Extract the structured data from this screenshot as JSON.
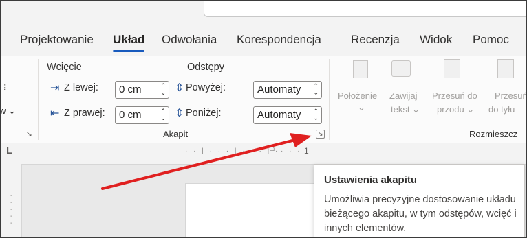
{
  "tabs": [
    "Projektowanie",
    "Układ",
    "Odwołania",
    "Korespondencja",
    "Recenzja",
    "Widok",
    "Pomoc"
  ],
  "active_tab": "Układ",
  "left_partial": {
    "dropdown_label": "w"
  },
  "indent": {
    "title": "Wcięcie",
    "left_label": "Z lewej:",
    "left_value": "0 cm",
    "right_label": "Z prawej:",
    "right_value": "0 cm"
  },
  "spacing": {
    "title": "Odstępy",
    "before_label": "Powyżej:",
    "before_value": "Automaty",
    "after_label": "Poniżej:",
    "after_value": "Automaty"
  },
  "group_label_paragraph": "Akapit",
  "arrange": {
    "position_l1": "Położenie",
    "wrap_l1": "Zawijaj",
    "wrap_l2": "tekst",
    "forward_l1": "Przesuń do",
    "forward_l2": "przodu",
    "backward_l1": "Przesuń",
    "backward_l2": "do tyłu",
    "group_label": "Rozmieszcz"
  },
  "ruler_number": "1",
  "tooltip": {
    "title": "Ustawienia akapitu",
    "description": "Umożliwia precyzyjne dostosowanie układu bieżącego akapitu, w tym odstępów, wcięć i innych elementów."
  },
  "colors": {
    "accent": "#185abd",
    "annotation_arrow": "#e02020"
  }
}
